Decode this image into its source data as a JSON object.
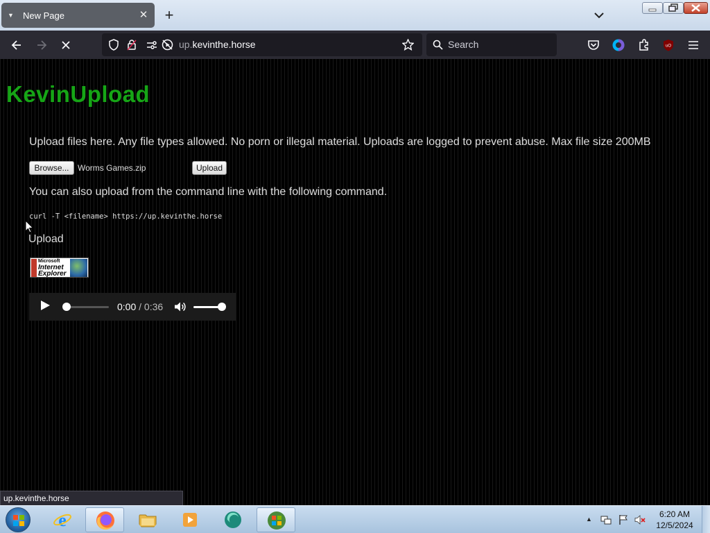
{
  "browser": {
    "tab_title": "New Page",
    "new_tab_label": "+",
    "url_dim": "up.",
    "url_main": "kevinthe.horse",
    "search_placeholder": "Search",
    "status_text": "up.kevinthe.horse"
  },
  "page": {
    "title": "KevinUpload",
    "intro": "Upload files here. Any file types allowed. No porn or illegal material. Uploads are logged to prevent abuse. Max file size 200MB",
    "browse_label": "Browse...",
    "selected_file": "Worms Games.zip",
    "upload_button_label": "Upload",
    "cli_text": "You can also upload from the command line with the following command.",
    "curl_command": "curl -T <filename> https://up.kevinthe.horse",
    "upload_link": "Upload",
    "badge": {
      "line1": "Microsoft",
      "line2": "Internet",
      "line3": "Explorer"
    },
    "audio": {
      "current": "0:00",
      "separator": " / ",
      "duration": "0:36",
      "progress": 0,
      "volume": 1
    }
  },
  "taskbar": {
    "clock_time": "6:20 AM",
    "clock_date": "12/5/2024"
  },
  "colors": {
    "title_green": "#16a516",
    "background": "#000000",
    "nav_bg": "#2b2a33"
  }
}
